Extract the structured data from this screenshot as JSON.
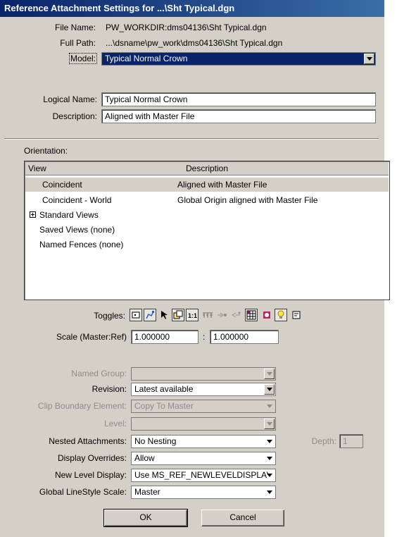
{
  "window": {
    "title": "Reference Attachment Settings for ...\\Sht Typical.dgn"
  },
  "file": {
    "file_name_label": "File Name:",
    "file_name_value": "PW_WORKDIR:dms04136\\Sht Typical.dgn",
    "full_path_label": "Full Path:",
    "full_path_value": "...\\dsname\\pw_work\\dms04136\\Sht Typical.dgn",
    "model_label": "Model:",
    "model_value": "Typical Normal Crown"
  },
  "logical": {
    "logical_name_label": "Logical Name:",
    "logical_name_value": "Typical Normal Crown",
    "description_label": "Description:",
    "description_value": "Aligned with Master File"
  },
  "orientation": {
    "label": "Orientation:",
    "columns": [
      "View",
      "Description"
    ],
    "rows": [
      {
        "view": "Coincident",
        "description": "Aligned with Master File",
        "selected": true
      },
      {
        "view": "Coincident - World",
        "description": "Global Origin aligned with Master File",
        "selected": false
      },
      {
        "view": "Standard Views",
        "description": "",
        "selected": false
      },
      {
        "view": "Saved Views (none)",
        "description": "",
        "selected": false
      },
      {
        "view": "Named Fences (none)",
        "description": "",
        "selected": false
      }
    ]
  },
  "toggles": {
    "label": "Toggles:",
    "icons": [
      "display-icon",
      "snap-icon",
      "locate-icon",
      "treat-as-element-icon",
      "true-scale-icon",
      "scale-line-styles-icon",
      "ignore-attachment-icon",
      "use-lights-icon",
      "level-overrides-icon",
      "annotation-icon",
      "light-bulb-icon",
      "book-icon"
    ]
  },
  "scale": {
    "label": "Scale (Master:Ref)",
    "master": "1.000000",
    "separator": ":",
    "ref": "1.000000"
  },
  "settings": {
    "named_group_label": "Named Group:",
    "named_group_value": "",
    "revision_label": "Revision:",
    "revision_value": "Latest available",
    "clip_boundary_label": "Clip Boundary Element:",
    "clip_boundary_value": "Copy To Master",
    "level_label": "Level:",
    "level_value": "",
    "nested_label": "Nested Attachments:",
    "nested_value": "No Nesting",
    "depth_label": "Depth:",
    "depth_value": "1",
    "display_overrides_label": "Display Overrides:",
    "display_overrides_value": "Allow",
    "new_level_label": "New Level Display:",
    "new_level_value": "Use MS_REF_NEWLEVELDISPLAY",
    "linestyle_label": "Global LineStyle Scale:",
    "linestyle_value": "Master"
  },
  "buttons": {
    "ok": "OK",
    "cancel": "Cancel"
  }
}
